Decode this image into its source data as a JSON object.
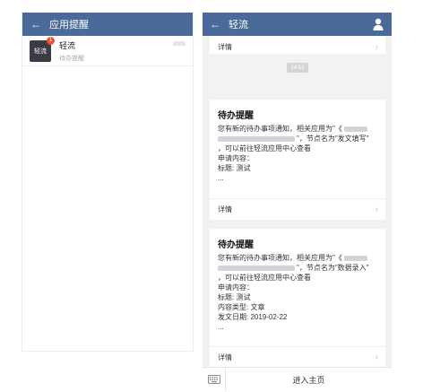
{
  "left": {
    "title": "应用提醒",
    "conversation": {
      "avatar_text": "轻流",
      "badge": "1",
      "name": "轻流",
      "subtitle": "待办提醒"
    }
  },
  "right": {
    "title": "轻流",
    "top_detail": "详情",
    "timestamp": "14:53",
    "card1": {
      "title": "待办提醒",
      "line1": "您有新的待办事项通知，相关应用为\"《",
      "line2": "\"，节点名为\"发文填写\"",
      "line3": "，可以前往轻流应用中心查看",
      "line4": "申请内容：",
      "line5": "标题: 测试",
      "line6": "...",
      "detail": "详情"
    },
    "card2": {
      "title": "待办提醒",
      "line1": "您有新的待办事项通知，相关应用为\"《",
      "line2": "\"，节点名为\"数据录入\"",
      "line3": "，可以前往轻流应用中心查看",
      "line4": "申请内容：",
      "line5": "标题: 测试",
      "line6": "内容类型: 文章",
      "line7": "发文日期: 2019-02-22",
      "line8": "...",
      "detail": "详情"
    },
    "bottom": {
      "home_label": "进入主页"
    }
  },
  "icons": {
    "back": "back-arrow-icon",
    "user": "user-icon",
    "keyboard": "keyboard-icon",
    "chevron": "chevron-right-icon"
  },
  "colors": {
    "header": "#4a6b9a",
    "badge": "#e5533d",
    "avatar": "#3b3b45",
    "background": "#f2f2f2"
  }
}
